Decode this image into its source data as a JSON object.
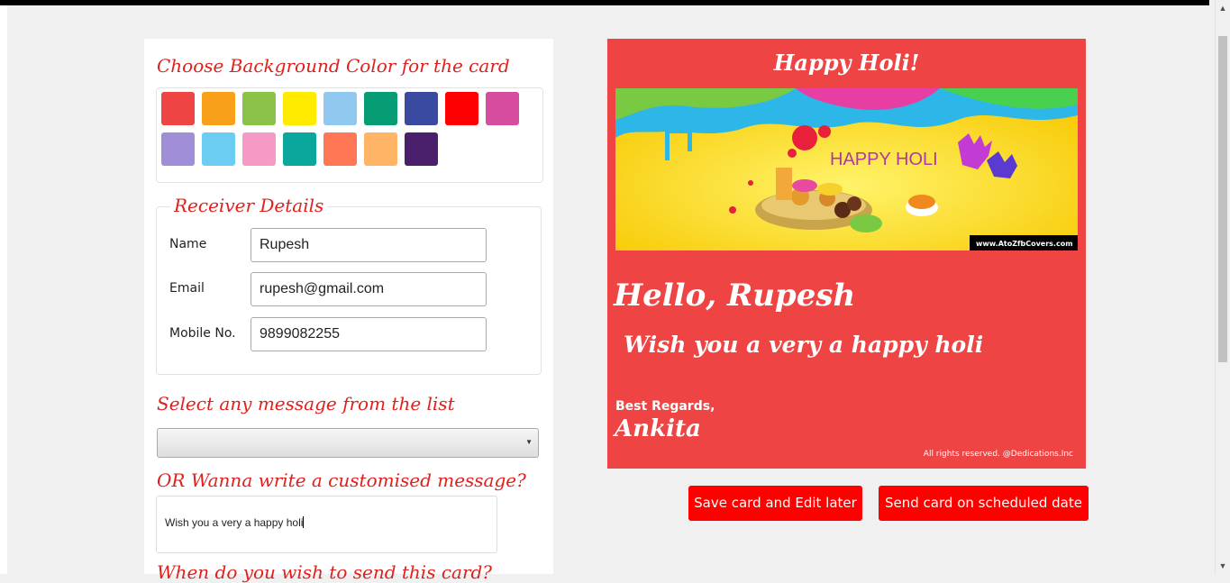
{
  "left_panel": {
    "bg_heading": "Choose Background Color for the card",
    "swatches": [
      "#ef4444",
      "#f9a01b",
      "#8bc34a",
      "#ffeb00",
      "#90c8ef",
      "#079c74",
      "#3a4aa0",
      "#ff0000",
      "#d64da0",
      "#a08fd8",
      "#6ccdf2",
      "#f49ac4",
      "#0aa89c",
      "#ff7755",
      "#ffb565",
      "#4a1f6c"
    ],
    "receiver_legend": "Receiver Details",
    "name_label": "Name",
    "name_value": "Rupesh",
    "email_label": "Email",
    "email_value": "rupesh@gmail.com",
    "mobile_label": "Mobile No.",
    "mobile_value": "9899082255",
    "select_heading": "Select any message from the list",
    "select_value": "",
    "custom_heading": "OR Wanna write a customised message?",
    "custom_value": "Wish you a very a happy holi",
    "next_heading_cut": "When do you wish to send this card?"
  },
  "card": {
    "title": "Happy Holi!",
    "image_text": "HAPPY HOLI",
    "image_watermark": "www.AtoZfbCovers.com",
    "greeting": "Hello, Rupesh",
    "message": "Wish you a very a happy holi",
    "regards": "Best Regards,",
    "sender": "Ankita",
    "footer": "All rights reserved. @Dedications.Inc"
  },
  "actions": {
    "save_label": "Save card and Edit later",
    "send_label": "Send card on scheduled date"
  }
}
